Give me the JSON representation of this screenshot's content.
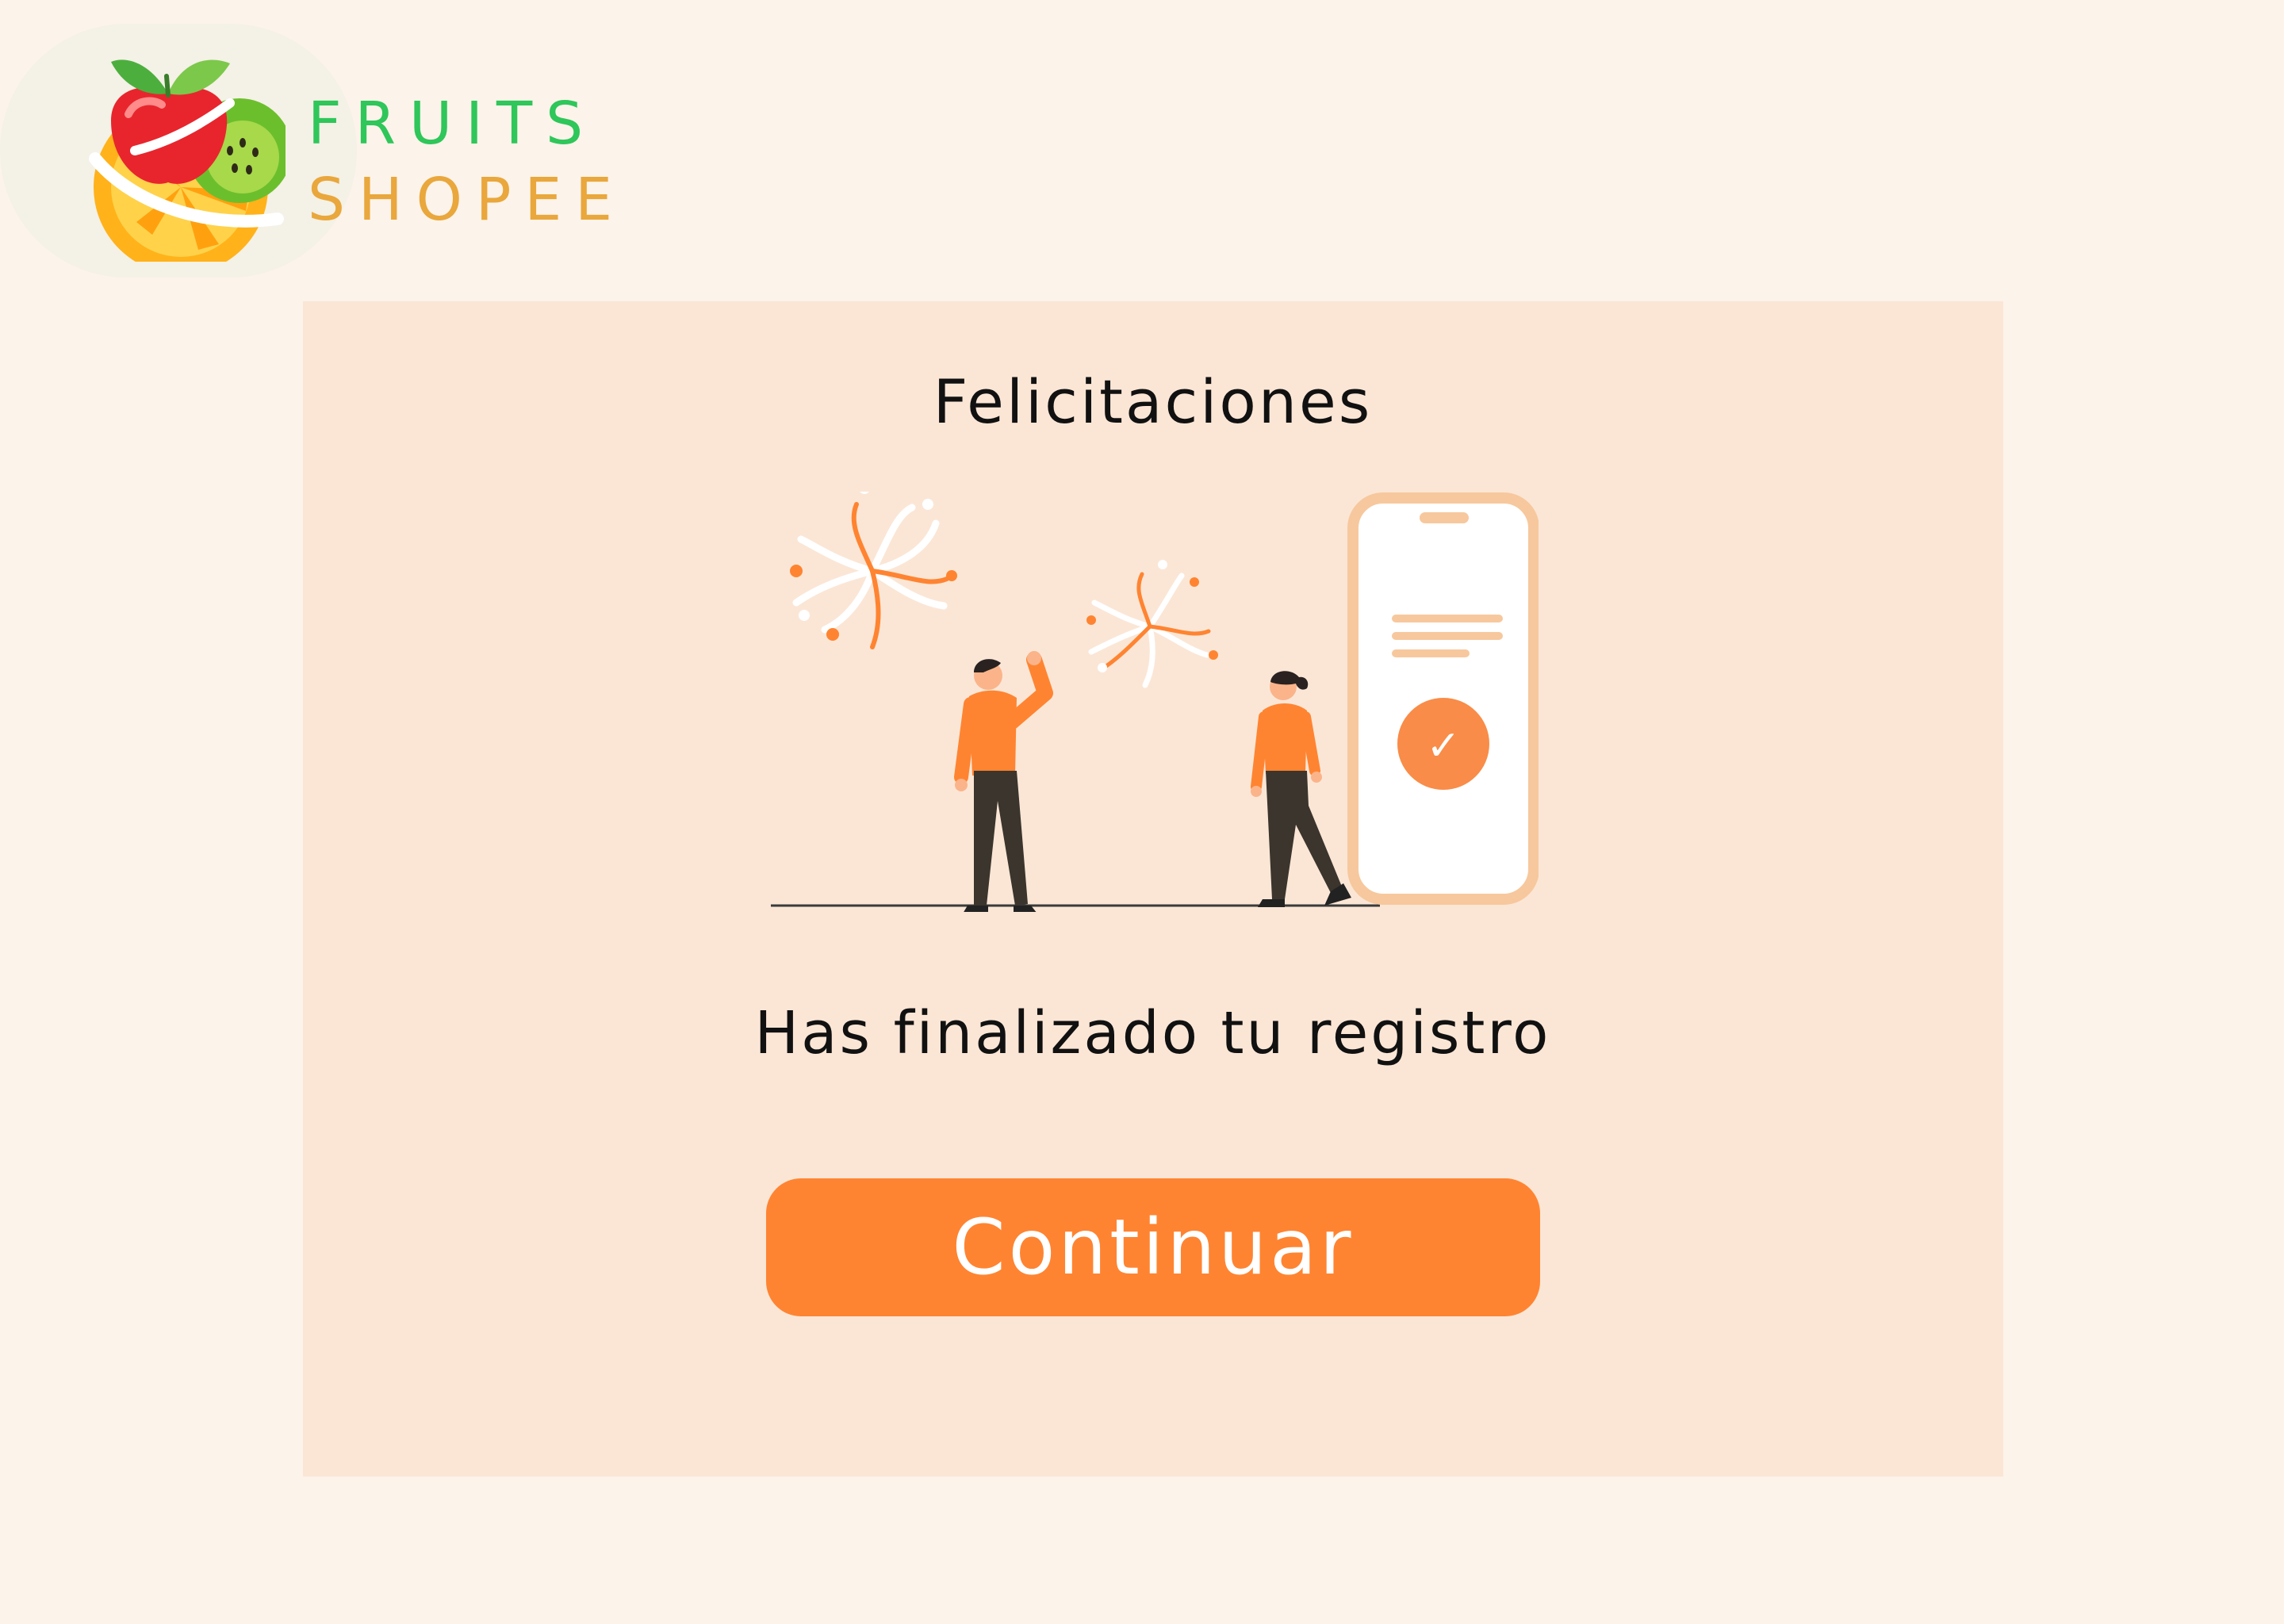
{
  "brand": {
    "line1": "FRUITS",
    "line2": "SHOPEE"
  },
  "card": {
    "title": "Felicitaciones",
    "message": "Has finalizado tu registro",
    "continue_label": "Continuar"
  },
  "phone_check": "✓",
  "colors": {
    "page_background": "#fcf3ea",
    "card_background": "#fbe6d6",
    "accent_orange": "#ff8431",
    "brand_green": "#2fc65a",
    "brand_gold": "#e9a73c"
  }
}
